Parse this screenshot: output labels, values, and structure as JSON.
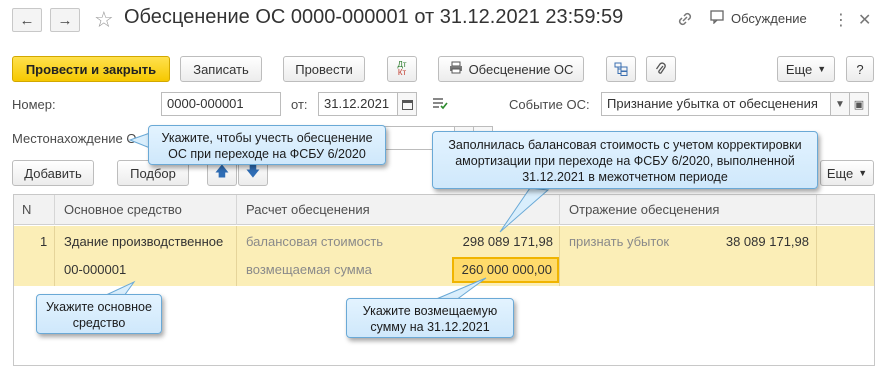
{
  "header": {
    "title": "Обесценение ОС 0000-000001 от 31.12.2021 23:59:59",
    "discussion": "Обсуждение"
  },
  "toolbar": {
    "post_close": "Провести и закрыть",
    "save": "Записать",
    "post": "Провести",
    "dt_kt_top": "Дт",
    "dt_kt_bottom": "Кт",
    "print": "Обесценение ОС",
    "more": "Еще",
    "help": "?"
  },
  "form": {
    "number_label": "Номер:",
    "number_value": "0000-000001",
    "date_label": "от:",
    "date_value": "31.12.2021",
    "event_label": "Событие ОС:",
    "event_value": "Признание убытка от обесценения",
    "location_label": "Местонахождение О"
  },
  "table_toolbar": {
    "add": "Добавить",
    "select": "Подбор",
    "more": "Еще"
  },
  "table": {
    "columns": [
      "N",
      "Основное средство",
      "Расчет обесценения",
      "Отражение обесценения"
    ],
    "row": {
      "n": "1",
      "asset_name": "Здание производственное",
      "asset_code": "00-000001",
      "calc_label_1": "балансовая стоимость",
      "calc_value_1": "298 089 171,98",
      "calc_label_2": "возмещаемая сумма",
      "calc_value_2": "260 000 000,00",
      "reflect_label": "признать убыток",
      "reflect_value": "38 089 171,98"
    }
  },
  "callouts": {
    "fsbu": "Укажите, чтобы учесть обесценение ОС при переходе на ФСБУ 6/2020",
    "balance": "Заполнилась балансовая стоимость с учетом корректировки амортизации при переходе на ФСБУ 6/2020, выполненной 31.12.2021 в межотчетном периоде",
    "asset": "Укажите основное средство",
    "recoverable": "Укажите возмещаемую сумму на 31.12.2021"
  },
  "icons": {
    "back": "arrow-left-icon",
    "forward": "arrow-right-icon",
    "favorite": "star-icon",
    "link": "link-icon",
    "discussion": "chat-icon",
    "menu": "kebab-icon",
    "close": "close-icon",
    "printer": "printer-icon",
    "structure": "hierarchy-icon",
    "attach": "paperclip-icon",
    "calendar": "calendar-icon",
    "up": "arrow-up-icon",
    "down": "arrow-down-icon"
  },
  "colors": {
    "primary_button": "#f6c800",
    "row_highlight": "#fbeeb7",
    "callout_fill": "#d9eefc",
    "callout_border": "#6aa9d6",
    "cell_focus_border": "#f0b400"
  }
}
